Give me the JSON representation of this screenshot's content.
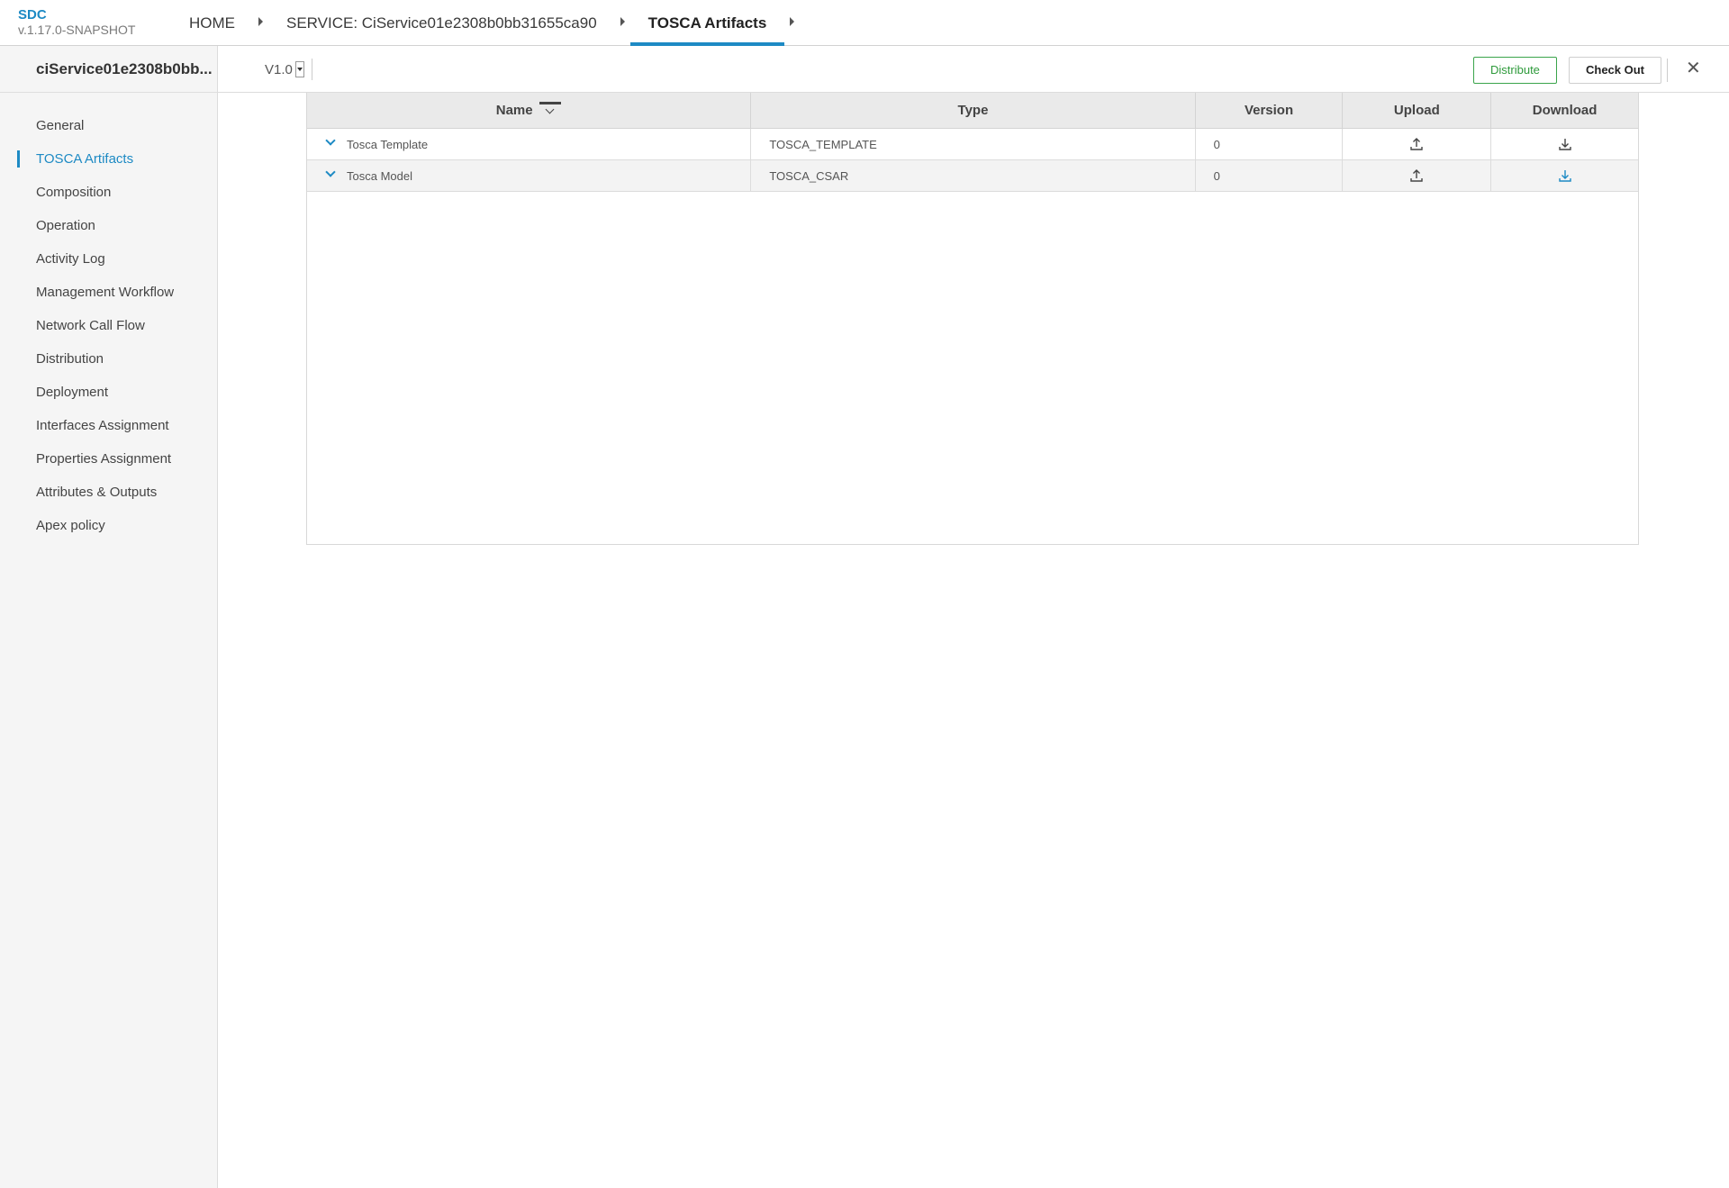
{
  "header": {
    "brand": "SDC",
    "version": "v.1.17.0-SNAPSHOT",
    "breadcrumbs": [
      {
        "label": "HOME"
      },
      {
        "label": "SERVICE: CiService01e2308b0bb31655ca90"
      },
      {
        "label": "TOSCA Artifacts"
      }
    ]
  },
  "sidebar": {
    "title": "ciService01e2308b0bb...",
    "items": [
      {
        "label": "General"
      },
      {
        "label": "TOSCA Artifacts"
      },
      {
        "label": "Composition"
      },
      {
        "label": "Operation"
      },
      {
        "label": "Activity Log"
      },
      {
        "label": "Management Workflow"
      },
      {
        "label": "Network Call Flow"
      },
      {
        "label": "Distribution"
      },
      {
        "label": "Deployment"
      },
      {
        "label": "Interfaces Assignment"
      },
      {
        "label": "Properties Assignment"
      },
      {
        "label": "Attributes & Outputs"
      },
      {
        "label": "Apex policy"
      }
    ],
    "selected": "TOSCA Artifacts"
  },
  "workspace": {
    "version": "V1.0",
    "distribute_label": "Distribute",
    "checkout_label": "Check Out",
    "close_icon": "close-icon",
    "colors": {
      "accent": "#1d8ac4",
      "distribute": "#3aa44b"
    }
  },
  "table": {
    "columns": [
      "Name",
      "Type",
      "Version",
      "Upload",
      "Download"
    ],
    "rows": [
      {
        "name": "Tosca Template",
        "type": "TOSCA_TEMPLATE",
        "version": "0",
        "upload_icon": "upload-icon",
        "download_icon": "download-icon"
      },
      {
        "name": "Tosca Model",
        "type": "TOSCA_CSAR",
        "version": "0",
        "upload_icon": "upload-icon",
        "download_icon": "download-icon"
      }
    ]
  }
}
